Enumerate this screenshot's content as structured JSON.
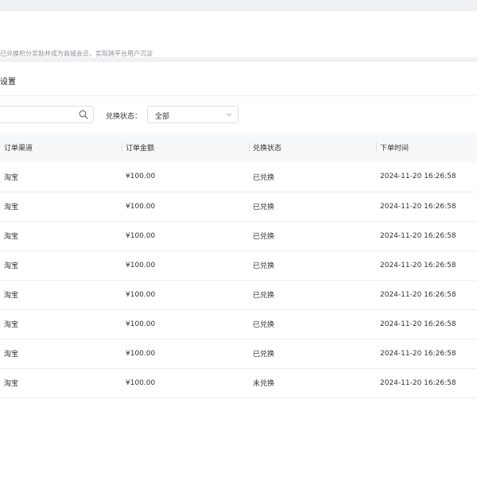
{
  "description": "已兑换积分奖励并成为商城会员，实现跨平台用户沉淀",
  "section_title": "设置",
  "filters": {
    "search_value": "",
    "status_label": "兑换状态：",
    "status_value": "全部"
  },
  "icons": {
    "search": "search-icon",
    "dropdown": "chevron-down-icon"
  },
  "table": {
    "columns": [
      "订单渠道",
      "订单金额",
      "兑换状态",
      "下单时间"
    ],
    "rows": [
      {
        "channel": "淘宝",
        "amount": "¥100.00",
        "status": "已兑换",
        "time": "2024-11-20 16:26:58"
      },
      {
        "channel": "淘宝",
        "amount": "¥100.00",
        "status": "已兑换",
        "time": "2024-11-20 16:26:58"
      },
      {
        "channel": "淘宝",
        "amount": "¥100.00",
        "status": "已兑换",
        "time": "2024-11-20 16:26:58"
      },
      {
        "channel": "淘宝",
        "amount": "¥100.00",
        "status": "已兑换",
        "time": "2024-11-20 16:26:58"
      },
      {
        "channel": "淘宝",
        "amount": "¥100.00",
        "status": "已兑换",
        "time": "2024-11-20 16:26:58"
      },
      {
        "channel": "淘宝",
        "amount": "¥100.00",
        "status": "已兑换",
        "time": "2024-11-20 16:26:58"
      },
      {
        "channel": "淘宝",
        "amount": "¥100.00",
        "status": "已兑换",
        "time": "2024-11-20 16:26:58"
      },
      {
        "channel": "淘宝",
        "amount": "¥100.00",
        "status": "未兑换",
        "time": "2024-11-20 16:26:58"
      }
    ]
  }
}
